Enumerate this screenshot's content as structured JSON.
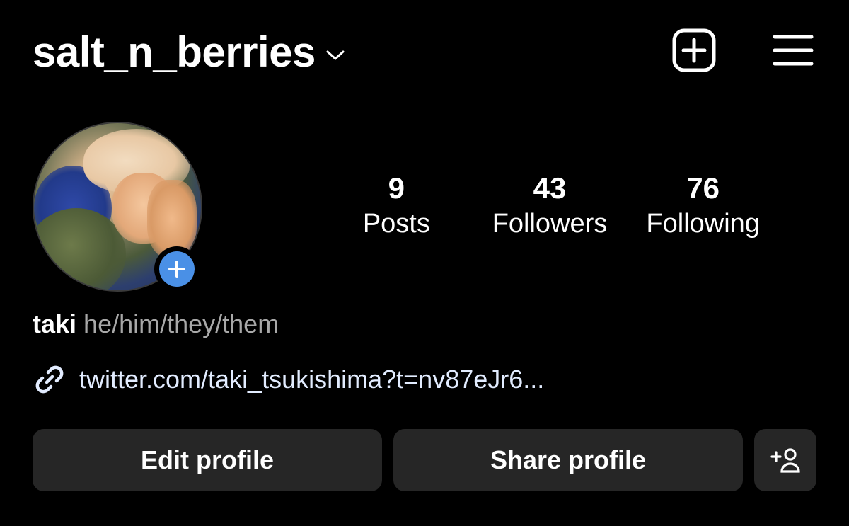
{
  "header": {
    "username": "salt_n_berries"
  },
  "icons": {
    "switch_account": "chevron-down-icon",
    "create": "plus-square-icon",
    "menu": "hamburger-menu-icon",
    "add_story": "plus-circle-icon",
    "link": "link-icon",
    "discover_people": "add-person-icon"
  },
  "colors": {
    "background": "#000000",
    "button_bg": "#262626",
    "add_story_blue": "#4a90e6",
    "secondary_text": "#a8a8a8"
  },
  "stats": [
    {
      "value": "9",
      "label": "Posts"
    },
    {
      "value": "43",
      "label": "Followers"
    },
    {
      "value": "76",
      "label": "Following"
    }
  ],
  "bio": {
    "name": "taki",
    "pronouns": "he/him/they/them",
    "link": "twitter.com/taki_tsukishima?t=nv87eJr6..."
  },
  "buttons": {
    "edit_profile": "Edit profile",
    "share_profile": "Share profile"
  }
}
